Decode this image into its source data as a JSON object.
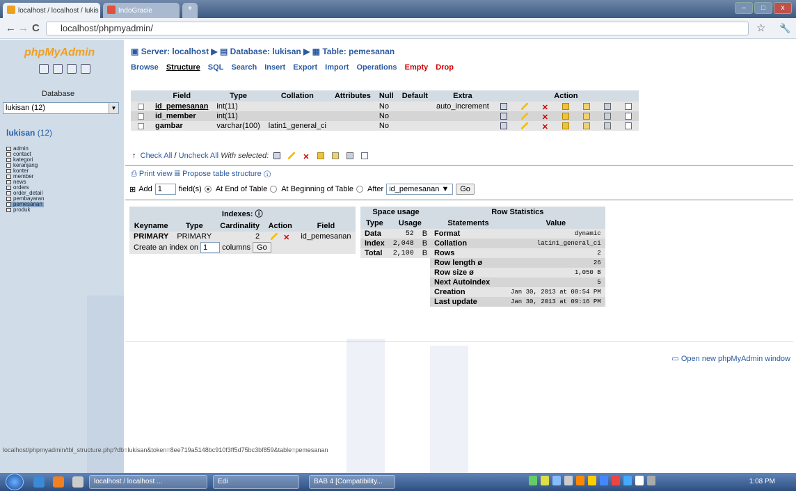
{
  "browser": {
    "tabs": [
      {
        "label": "localhost / localhost / lukis"
      },
      {
        "label": "IndoGracie"
      }
    ],
    "new_tab_label": "+",
    "url": "localhost/phpmyadmin/",
    "back": "←",
    "forward": "→",
    "reload": "C",
    "bookmark": "☆",
    "wrench": "🔧",
    "window_buttons": [
      "–",
      "□",
      "x"
    ]
  },
  "sidebar": {
    "logo_a": "php",
    "logo_b": "MyAdmin",
    "database_label": "Database",
    "database_select": "lukisan (12)",
    "db_title": "lukisan",
    "db_count": "(12)",
    "tables": [
      "admin",
      "contact",
      "kategori",
      "keranjang",
      "konter",
      "member",
      "news",
      "orders",
      "order_detail",
      "pembayaran",
      "pemesanan",
      "produk"
    ]
  },
  "breadcrumb": {
    "server": "Server: localhost",
    "database": "Database: lukisan",
    "table": "Table: pemesanan",
    "sep": "▶"
  },
  "tabs": {
    "browse": "Browse",
    "structure": "Structure",
    "sql": "SQL",
    "search": "Search",
    "insert": "Insert",
    "export": "Export",
    "import": "Import",
    "operations": "Operations",
    "empty": "Empty",
    "drop": "Drop"
  },
  "structure": {
    "headers": {
      "field": "Field",
      "type": "Type",
      "collation": "Collation",
      "attributes": "Attributes",
      "null": "Null",
      "default": "Default",
      "extra": "Extra",
      "action": "Action"
    },
    "rows": [
      {
        "field": "id_pemesanan",
        "type": "int(11)",
        "collation": "",
        "attributes": "",
        "null": "No",
        "default": "",
        "extra": "auto_increment"
      },
      {
        "field": "id_member",
        "type": "int(11)",
        "collation": "",
        "attributes": "",
        "null": "No",
        "default": "",
        "extra": ""
      },
      {
        "field": "gambar",
        "type": "varchar(100)",
        "collation": "latin1_general_ci",
        "attributes": "",
        "null": "No",
        "default": "",
        "extra": ""
      }
    ]
  },
  "check": {
    "check_all": "Check All",
    "slash": " / ",
    "uncheck_all": "Uncheck All",
    "with_selected": "With selected:"
  },
  "print": {
    "print_view": "Print view",
    "propose": "Propose table structure"
  },
  "add": {
    "label": "Add",
    "count": "1",
    "fields_text": "field(s)",
    "end": "At End of Table",
    "beginning": "At Beginning of Table",
    "after": "After",
    "after_field": "id_pemesanan",
    "go": "Go"
  },
  "indexes": {
    "title": "Indexes:",
    "headers": {
      "keyname": "Keyname",
      "type": "Type",
      "cardinality": "Cardinality",
      "action": "Action",
      "field": "Field"
    },
    "row": {
      "keyname": "PRIMARY",
      "type": "PRIMARY",
      "cardinality": "2",
      "field": "id_pemesanan"
    },
    "create_a": "Create an index on",
    "create_count": "1",
    "create_b": "columns",
    "go": "Go"
  },
  "space": {
    "title": "Space usage",
    "headers": {
      "type": "Type",
      "usage": "Usage"
    },
    "rows": [
      {
        "type": "Data",
        "value": "52",
        "unit": "B"
      },
      {
        "type": "Index",
        "value": "2,048",
        "unit": "B"
      },
      {
        "type": "Total",
        "value": "2,100",
        "unit": "B"
      }
    ]
  },
  "rowstats": {
    "title": "Row Statistics",
    "headers": {
      "statements": "Statements",
      "value": "Value"
    },
    "rows": [
      {
        "label": "Format",
        "value": "dynamic"
      },
      {
        "label": "Collation",
        "value": "latin1_general_ci"
      },
      {
        "label": "Rows",
        "value": "2"
      },
      {
        "label": "Row length ø",
        "value": "26"
      },
      {
        "label": "Row size ø",
        "value": "1,050 B"
      },
      {
        "label": "Next Autoindex",
        "value": "5"
      },
      {
        "label": "Creation",
        "value": "Jan 30, 2013 at 08:54 PM"
      },
      {
        "label": "Last update",
        "value": "Jan 30, 2013 at 09:16 PM"
      }
    ]
  },
  "open_window": "Open new phpMyAdmin window",
  "status_url": "localhost/phpmyadmin/tbl_structure.php?db=lukisan&token=8ee719a5148bc910f3ff5d75bc3bf859&table=pemesanan",
  "taskbar": {
    "items": [
      "localhost / localhost ...",
      "Edi",
      "BAB 4 [Compatibility..."
    ],
    "clock": "1:08 PM"
  }
}
